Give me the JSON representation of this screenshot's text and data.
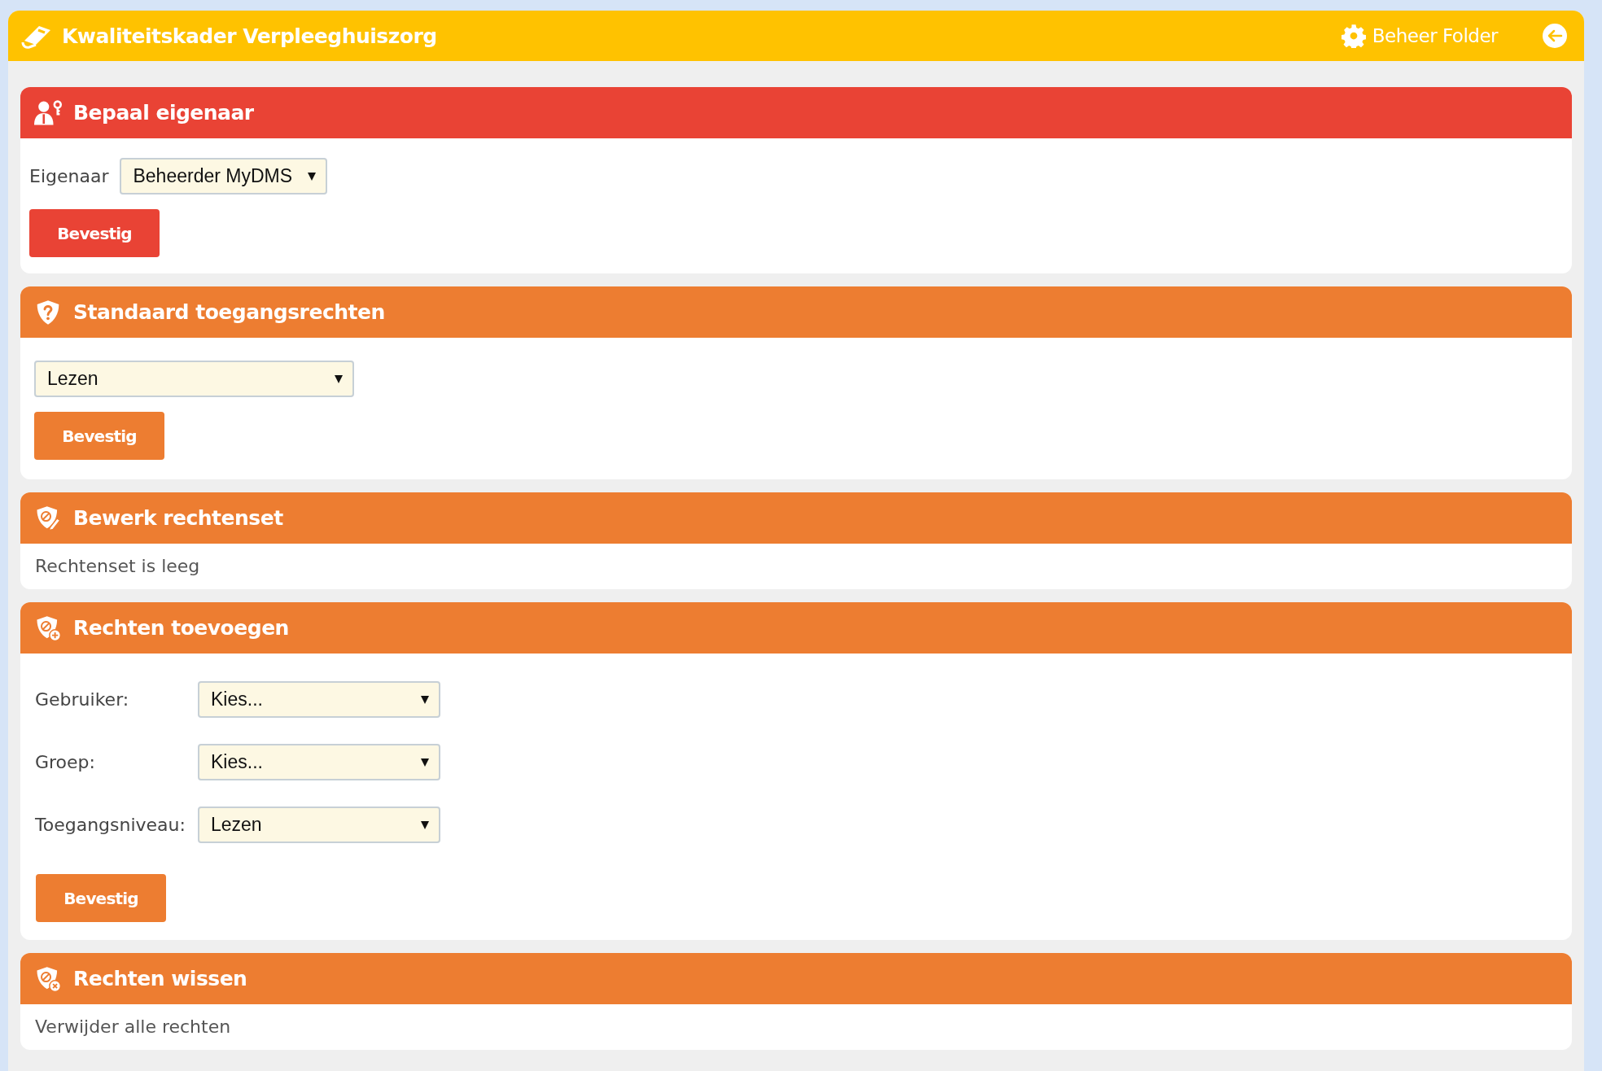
{
  "header": {
    "title": "Kwaliteitskader Verpleeghuiszorg",
    "action": "Beheer Folder"
  },
  "sections": [
    {
      "kind": "owner",
      "title": "Bepaal eigenaar",
      "color": "#e94335",
      "label": "Eigenaar",
      "select": "Beheerder MyDMS",
      "button": "Bevestig"
    },
    {
      "kind": "select",
      "title": "Standaard toegangsrechten",
      "color": "#ed7d31",
      "select": "Lezen",
      "button": "Bevestig"
    },
    {
      "kind": "text",
      "title": "Bewerk rechtenset",
      "color": "#ed7d31",
      "text": "Rechtenset is leeg"
    },
    {
      "kind": "form",
      "title": "Rechten toevoegen",
      "color": "#ed7d31",
      "rows": [
        {
          "label": "Gebruiker:",
          "select": "Kies..."
        },
        {
          "label": "Groep:",
          "select": "Kies..."
        },
        {
          "label": "Toegangsniveau:",
          "select": "Lezen"
        }
      ],
      "button": "Bevestig"
    },
    {
      "kind": "text",
      "title": "Rechten wissen",
      "color": "#ed7d31",
      "text": "Verwijder alle rechten"
    }
  ]
}
